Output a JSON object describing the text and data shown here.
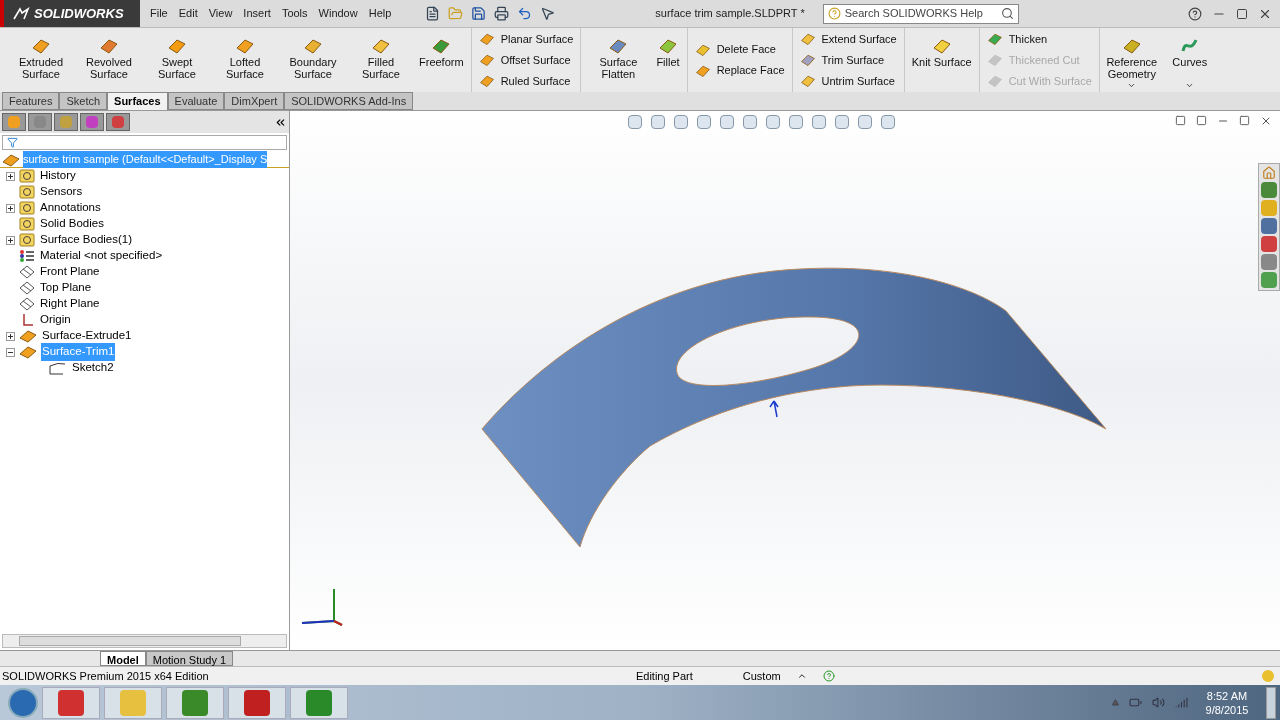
{
  "title_bar": {
    "logo": "SOLIDWORKS",
    "menu": [
      "File",
      "Edit",
      "View",
      "Insert",
      "Tools",
      "Window",
      "Help"
    ],
    "document_title": "surface trim sample.SLDPRT *",
    "search": {
      "placeholder": "Search SOLIDWORKS Help"
    }
  },
  "ribbon": [
    {
      "kind": "large",
      "items": [
        {
          "label": "Extruded Surface",
          "disabled": false
        },
        {
          "label": "Revolved Surface",
          "disabled": false
        },
        {
          "label": "Swept Surface",
          "disabled": false
        },
        {
          "label": "Lofted Surface",
          "disabled": false
        },
        {
          "label": "Boundary Surface",
          "disabled": false
        },
        {
          "label": "Filled Surface",
          "disabled": false
        },
        {
          "label": "Freeform",
          "disabled": false
        }
      ]
    },
    {
      "kind": "stack",
      "items": [
        {
          "label": "Planar Surface",
          "disabled": false
        },
        {
          "label": "Offset Surface",
          "disabled": false
        },
        {
          "label": "Ruled Surface",
          "disabled": false
        }
      ]
    },
    {
      "kind": "large",
      "items": [
        {
          "label": "Surface Flatten",
          "disabled": false
        },
        {
          "label": "Fillet",
          "disabled": false
        }
      ]
    },
    {
      "kind": "stack",
      "items": [
        {
          "label": "Delete Face",
          "disabled": false
        },
        {
          "label": "Replace Face",
          "disabled": false
        }
      ]
    },
    {
      "kind": "stack",
      "items": [
        {
          "label": "Extend Surface",
          "disabled": false
        },
        {
          "label": "Trim Surface",
          "disabled": false
        },
        {
          "label": "Untrim Surface",
          "disabled": false
        }
      ]
    },
    {
      "kind": "large",
      "items": [
        {
          "label": "Knit Surface",
          "disabled": false
        }
      ]
    },
    {
      "kind": "stack",
      "items": [
        {
          "label": "Thicken",
          "disabled": false
        },
        {
          "label": "Thickened Cut",
          "disabled": true
        },
        {
          "label": "Cut With Surface",
          "disabled": true
        }
      ]
    },
    {
      "kind": "dropdown",
      "items": [
        {
          "label": "Reference Geometry",
          "disabled": false
        },
        {
          "label": "Curves",
          "disabled": false
        }
      ]
    }
  ],
  "command_tabs": [
    {
      "label": "Features",
      "selected": false
    },
    {
      "label": "Sketch",
      "selected": false
    },
    {
      "label": "Surfaces",
      "selected": true
    },
    {
      "label": "Evaluate",
      "selected": false
    },
    {
      "label": "DimXpert",
      "selected": false
    },
    {
      "label": "SOLIDWORKS Add-Ins",
      "selected": false
    }
  ],
  "feature_tree": {
    "root": {
      "label": "surface trim sample  (Default<<Default>_Display S",
      "selected": true
    },
    "items": [
      {
        "label": "History",
        "kind": "folder",
        "has_toggle": true,
        "expanded": false,
        "selected": false
      },
      {
        "label": "Sensors",
        "kind": "folder",
        "has_toggle": false,
        "expanded": false,
        "selected": false
      },
      {
        "label": "Annotations",
        "kind": "folder",
        "has_toggle": true,
        "expanded": false,
        "selected": false
      },
      {
        "label": "Solid Bodies",
        "kind": "folder",
        "has_toggle": false,
        "expanded": false,
        "selected": false
      },
      {
        "label": "Surface Bodies(1)",
        "kind": "folder",
        "has_toggle": true,
        "expanded": false,
        "selected": false
      },
      {
        "label": "Material <not specified>",
        "kind": "material",
        "has_toggle": false,
        "expanded": false,
        "selected": false
      },
      {
        "label": "Front Plane",
        "kind": "plane",
        "has_toggle": false,
        "expanded": false,
        "selected": false
      },
      {
        "label": "Top Plane",
        "kind": "plane",
        "has_toggle": false,
        "expanded": false,
        "selected": false
      },
      {
        "label": "Right Plane",
        "kind": "plane",
        "has_toggle": false,
        "expanded": false,
        "selected": false
      },
      {
        "label": "Origin",
        "kind": "origin",
        "has_toggle": false,
        "expanded": false,
        "selected": false
      },
      {
        "label": "Surface-Extrude1",
        "kind": "feature",
        "has_toggle": true,
        "expanded": false,
        "selected": false
      },
      {
        "label": "Surface-Trim1",
        "kind": "feature",
        "has_toggle": true,
        "expanded": true,
        "selected": true,
        "children": [
          {
            "label": "Sketch2",
            "kind": "sketch",
            "has_toggle": false,
            "expanded": false,
            "selected": false
          }
        ]
      }
    ]
  },
  "bottom_tabs": [
    {
      "label": "Model",
      "selected": true
    },
    {
      "label": "Motion Study 1",
      "selected": false
    }
  ],
  "status_bar": {
    "product": "SOLIDWORKS Premium 2015 x64 Edition",
    "mode": "Editing Part",
    "units": "Custom"
  },
  "taskbar": {
    "time": "8:52 AM",
    "date": "9/8/2015"
  }
}
